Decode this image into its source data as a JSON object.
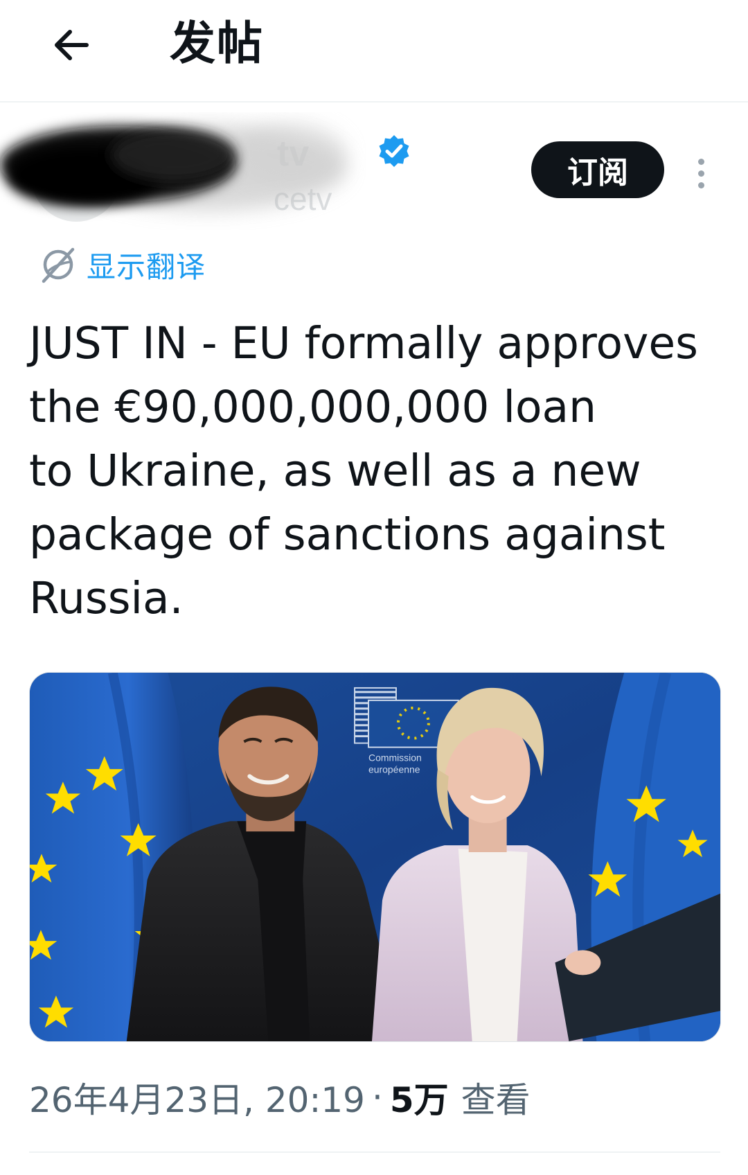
{
  "header": {
    "title": "发帖",
    "back_icon": "arrow-left-icon"
  },
  "author": {
    "display_name": "tv",
    "handle": "cetv",
    "verified": true,
    "verified_color": "#1d9bf0",
    "subscribe_label": "订阅",
    "more_icon": "more-vertical-icon"
  },
  "translate": {
    "label": "显示翻译",
    "icon": "globe-translate-icon"
  },
  "tweet": {
    "text": "JUST IN - EU formally approves\nthe €90,000,000,000 loan\nto Ukraine, as well as a new\npackage of sanctions against\nRussia."
  },
  "media": {
    "type": "photo",
    "sign_text_line1": "Commission",
    "sign_text_line2": "européenne"
  },
  "meta": {
    "datetime": "26年4月23日, 20:19",
    "separator": "·",
    "views_count": "5万",
    "views_label": "查看"
  },
  "colors": {
    "accent": "#1d9bf0",
    "text_primary": "#0f1419",
    "text_secondary": "#536471",
    "eu_blue": "#1e4fa0",
    "eu_gold": "#ffdd00"
  }
}
